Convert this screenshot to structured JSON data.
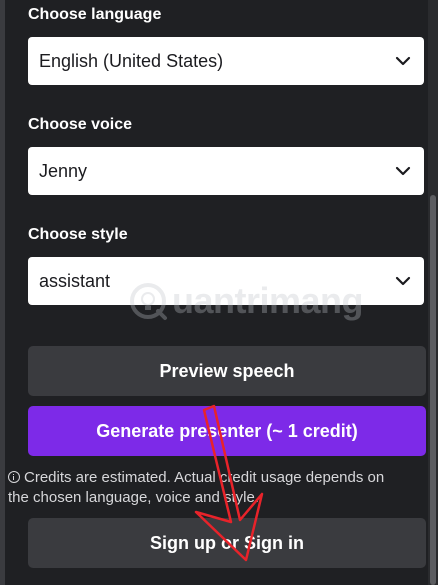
{
  "form": {
    "language": {
      "label": "Choose language",
      "value": "English (United States)"
    },
    "voice": {
      "label": "Choose voice",
      "value": "Jenny"
    },
    "style": {
      "label": "Choose style",
      "value": "assistant"
    }
  },
  "buttons": {
    "preview": "Preview speech",
    "generate": "Generate presenter (~ 1 credit)",
    "sign_in": "Sign up or Sign in"
  },
  "note": {
    "text": "Credits are estimated. Actual credit usage depends on the chosen language, voice and style."
  },
  "watermark": {
    "text": "uantrimang"
  },
  "colors": {
    "background": "#1f2023",
    "dark_button": "#3a3b3f",
    "accent_purple": "#7d2ae8",
    "annotation_red": "#e8232a"
  },
  "icons": {
    "select_chevron": "chevron-down-icon",
    "note_icon": "info-icon",
    "annotation": "red-arrow-icon",
    "watermark_logo": "bulb-logo-icon"
  }
}
